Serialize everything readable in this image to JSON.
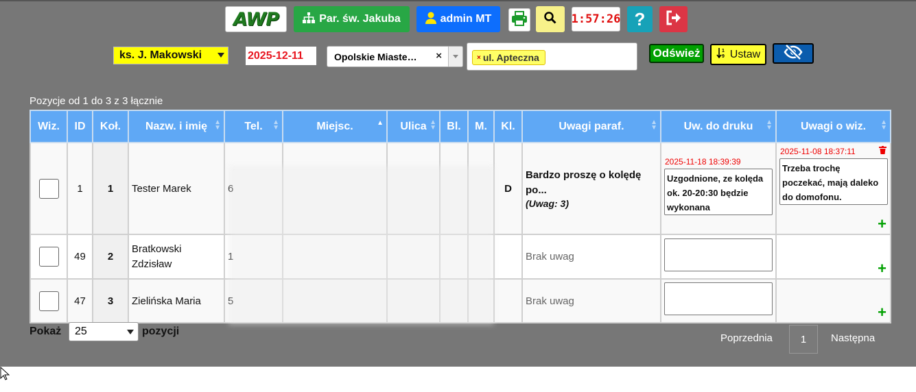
{
  "header": {
    "logo_text": "AWP",
    "parish_label": "Par. św. Jakuba",
    "user_label": "admin MT",
    "clock": "1:57:26",
    "help_label": "?"
  },
  "filters": {
    "priest": "ks. J. Makowski",
    "date": "2025-12-11",
    "place": "Opolskie Miaste…",
    "place_clear": "×",
    "street_tag": "ul. Apteczna",
    "street_tag_remove": "×",
    "refresh_label": "Odśwież",
    "set_label": "Ustaw"
  },
  "table": {
    "info": "Pozycje od 1 do 3 z 3 łącznie",
    "columns": [
      "Wiz.",
      "ID",
      "Koł.",
      "Nazw. i imię",
      "Tel.",
      "Miejsc.",
      "Ulica",
      "Bl.",
      "M.",
      "Kl.",
      "Uwagi paraf.",
      "Uw. do druku",
      "Uwagi o wiz."
    ],
    "rows": [
      {
        "id": "1",
        "kol": "1",
        "name": "Tester Marek",
        "tel": "6",
        "kl": "D",
        "uwagi_paraf": "Bardzo proszę o kolędę po...",
        "uwagi_paraf_note": "(Uwag: 3)",
        "druk_stamp": "2025-11-18 18:39:39",
        "druk_text": "Uzgodnione, ze kolęda ok. 20-20:30 będzie wykonana",
        "wiz_stamp": "2025-11-08 18:37:11",
        "wiz_text": "Trzeba trochę poczekać, mają daleko do domofonu."
      },
      {
        "id": "49",
        "kol": "2",
        "name": "Bratkowski Zdzisław",
        "tel": "1",
        "kl": "",
        "uwagi_paraf": "Brak uwag",
        "druk_text": "",
        "wiz_text": ""
      },
      {
        "id": "47",
        "kol": "3",
        "name": "Zielińska Maria",
        "tel": "5",
        "kl": "",
        "uwagi_paraf": "Brak uwag",
        "druk_text": "",
        "wiz_text": ""
      }
    ],
    "plus": "+"
  },
  "footer": {
    "show_label": "Pokaż",
    "page_size": "25",
    "positions_label": "pozycji",
    "prev_label": "Poprzednia",
    "page": "1",
    "next_label": "Następna"
  },
  "colors": {
    "background": "#777777",
    "header_blue": "#5fa8f5",
    "green": "#28a745",
    "blue": "#0d6efd",
    "red": "#dc3545",
    "yellow": "#ffff00"
  }
}
